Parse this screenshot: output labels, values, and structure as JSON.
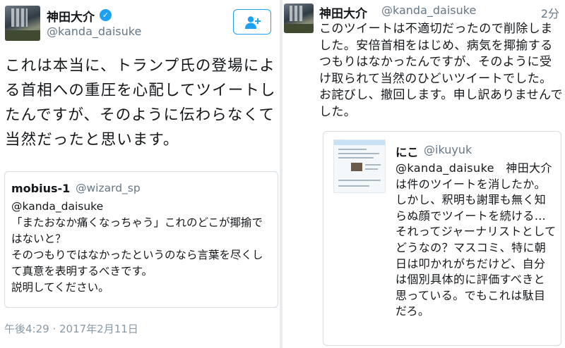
{
  "left_tweet": {
    "author_name": "神田大介",
    "author_handle": "@kanda_daisuke",
    "verified_icon": "verified-badge-icon",
    "follow_icon": "add-user-icon",
    "text": "これは本当に、トランプ氏の登場による首相への重圧を心配してツイートしたんですが、そのように伝わらなくて当然だったと思います。",
    "quoted": {
      "name": "mobius-1",
      "handle": "@wizard_sp",
      "text": "@kanda_daisuke\n「またおなか痛くなっちゃう」これのどこが揶揄ではないと？\nそのつもりではなかったというのなら言葉を尽くして真意を表明するべきです。\n説明してください。"
    },
    "timestamp": "午後4:29 · 2017年2月11日"
  },
  "right_tweet": {
    "author_name": "神田大介",
    "author_handle": "@kanda_daisuke",
    "time": "2分",
    "text": "このツイートは不適切だったので削除しました。安倍首相をはじめ、病気を揶揄するつもりはなかったんですが、そのように受け取られて当然のひどいツイートでした。お詫びし、撤回します。申し訳ありませんでした。",
    "quoted": {
      "name": "にこ",
      "handle": "@ikuyuk",
      "text": "@kanda_daisuke　神田大介は件のツイートを消したか。\nしかし、釈明も謝罪も無く知らぬ顔でツイートを続ける…それってジャーナリストとしてどうなの？マスコミ、特に朝日は叩かれがちだけど、自分は個別具体的に評価すべきと思っている。でもこれは駄目だろ。"
    }
  },
  "colors": {
    "accent": "#1da1f2",
    "muted": "#657786",
    "border": "#d5dbe0"
  }
}
